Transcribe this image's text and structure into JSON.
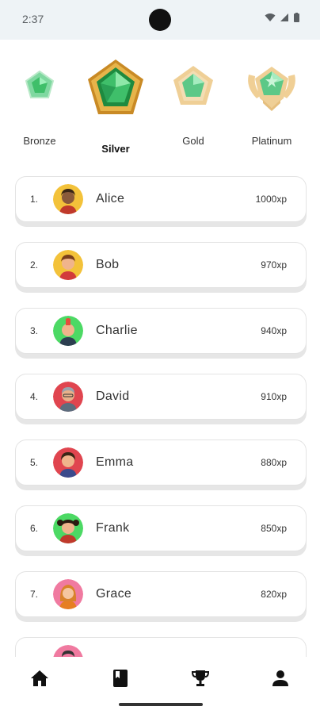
{
  "status": {
    "time": "2:37"
  },
  "leagues": [
    {
      "label": "Bronze",
      "active": false
    },
    {
      "label": "Silver",
      "active": true
    },
    {
      "label": "Gold",
      "active": false
    },
    {
      "label": "Platinum",
      "active": false
    }
  ],
  "leaderboard": [
    {
      "rank": "1.",
      "name": "Alice",
      "xp": "1000xp"
    },
    {
      "rank": "2.",
      "name": "Bob",
      "xp": "970xp"
    },
    {
      "rank": "3.",
      "name": "Charlie",
      "xp": "940xp"
    },
    {
      "rank": "4.",
      "name": "David",
      "xp": "910xp"
    },
    {
      "rank": "5.",
      "name": "Emma",
      "xp": "880xp"
    },
    {
      "rank": "6.",
      "name": "Frank",
      "xp": "850xp"
    },
    {
      "rank": "7.",
      "name": "Grace",
      "xp": "820xp"
    },
    {
      "rank": "",
      "name": "",
      "xp": ""
    }
  ],
  "nav": [
    {
      "icon": "home-icon"
    },
    {
      "icon": "book-icon"
    },
    {
      "icon": "trophy-icon"
    },
    {
      "icon": "person-icon"
    }
  ],
  "colors": {
    "gem": "#3fbf6a",
    "gold_frame": "#d8a640"
  }
}
